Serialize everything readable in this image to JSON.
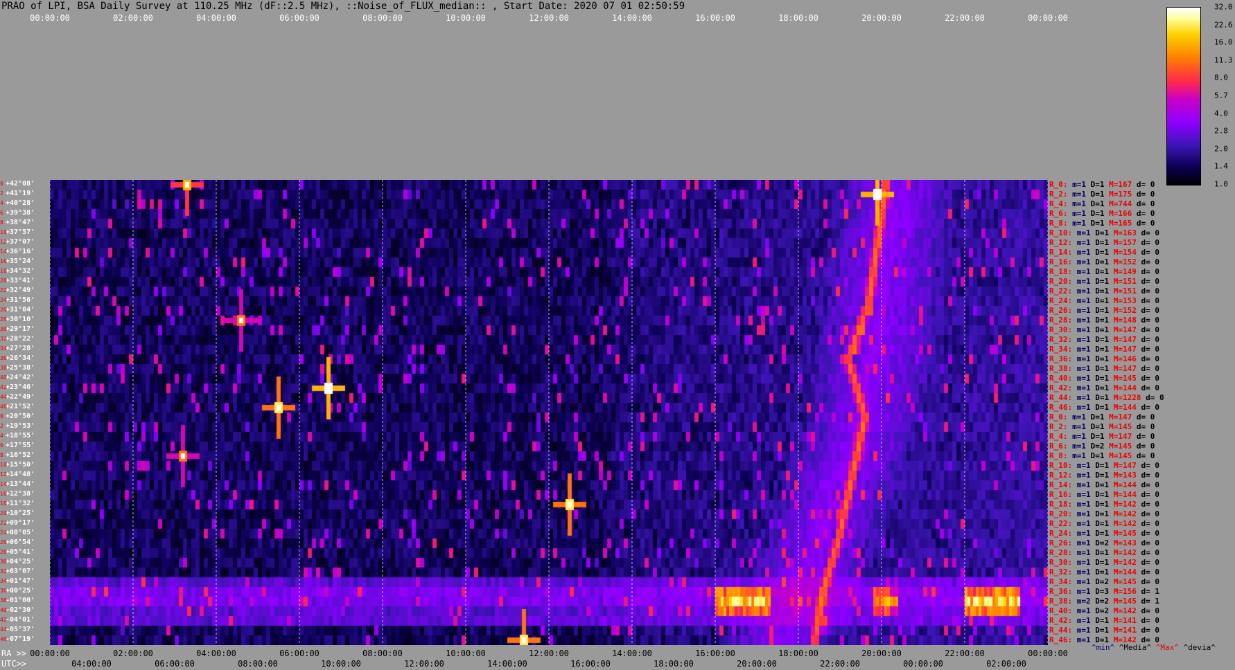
{
  "title": "PRAO of LPI, BSA Daily Survey at 110.25 MHz (dF::2.5 MHz), ::Noise_of_FLUX_median:: , Start Date: 2020 07 01 02:50:59",
  "top_axis_ticks": [
    "00:00:00",
    "02:00:00",
    "04:00:00",
    "06:00:00",
    "08:00:00",
    "10:00:00",
    "12:00:00",
    "14:00:00",
    "16:00:00",
    "18:00:00",
    "20:00:00",
    "22:00:00",
    "00:00:00"
  ],
  "ra_axis": {
    "label": "RA >>",
    "ticks": [
      "00:00:00",
      "02:00:00",
      "04:00:00",
      "06:00:00",
      "08:00:00",
      "10:00:00",
      "12:00:00",
      "14:00:00",
      "16:00:00",
      "18:00:00",
      "20:00:00",
      "22:00:00",
      "00:00:00"
    ]
  },
  "utc_axis": {
    "label": "UTC>>",
    "ticks": [
      "04:00:00",
      "06:00:00",
      "08:00:00",
      "10:00:00",
      "12:00:00",
      "14:00:00",
      "16:00:00",
      "18:00:00",
      "20:00:00",
      "22:00:00",
      "00:00:00",
      "02:00:00"
    ]
  },
  "colorbar_ticks": [
    "32.0",
    "22.6",
    "16.0",
    "11.3",
    "8.0",
    "5.7",
    "4.0",
    "2.8",
    "2.0",
    "1.4",
    "1.0"
  ],
  "legend_footer": [
    {
      "text": "^min^",
      "color": "#000080"
    },
    {
      "text": "^Media^",
      "color": "#000000"
    },
    {
      "text": "^Max^",
      "color": "#e00000"
    },
    {
      "text": "^devia^",
      "color": "#000000"
    }
  ],
  "chart_data": {
    "type": "heatmap",
    "title": "PRAO of LPI, BSA Daily Survey at 110.25 MHz (dF::2.5 MHz), ::Noise_of_FLUX_median:: , Start Date: 2020 07 01 02:50:59",
    "x_axis": "RA (hh:mm:ss), 00:00:00 to 24:00:00",
    "color_scale": {
      "min": 1.0,
      "max": 32.0,
      "type": "log2"
    },
    "declination_labels": [
      "+42°08'",
      "+41°19'",
      "+40°28'",
      "+39°38'",
      "+38°47'",
      "+37°57'",
      "+37°07'",
      "+36°16'",
      "+35°24'",
      "+34°32'",
      "+33°41'",
      "+32°49'",
      "+31°56'",
      "+31°04'",
      "+30°10'",
      "+29°17'",
      "+28°22'",
      "+27°28'",
      "+26°34'",
      "+25°38'",
      "+24°42'",
      "+23°46'",
      "+22°49'",
      "+21°52'",
      "+20°50'",
      "+19°53'",
      "+18°55'",
      "+17°55'",
      "+16°52'",
      "+15°50'",
      "+14°48'",
      "+13°44'",
      "+12°38'",
      "+11°32'",
      "+10°25'",
      "+09°17'",
      "+08°05'",
      "+06°54'",
      "+05°41'",
      "+04°25'",
      "+03°07'",
      "+01°47'",
      "+00°25'",
      "-01°00'",
      "-02°30'",
      "-04°01'",
      "-05°37'",
      "-07°19'"
    ],
    "row_index_labels": [
      "0",
      "2",
      "4",
      "6",
      "8",
      "10",
      "12",
      "14",
      "16",
      "18",
      "20",
      "22",
      "24",
      "26",
      "28",
      "30",
      "32",
      "34",
      "36",
      "38",
      "40",
      "42",
      "44",
      "46",
      "0",
      "2",
      "4",
      "6",
      "8",
      "10",
      "12",
      "14",
      "16",
      "18",
      "20",
      "22",
      "24",
      "26",
      "28",
      "30",
      "32",
      "34",
      "36",
      "38",
      "40",
      "42",
      "44",
      "46"
    ],
    "rows": [
      {
        "name": "R_0:",
        "min": "m=1",
        "d": "D=1",
        "max": "M=167",
        "dev": "d= 0"
      },
      {
        "name": "R_2:",
        "min": "m=1",
        "d": "D=1",
        "max": "M=175",
        "dev": "d= 0"
      },
      {
        "name": "R_4:",
        "min": "m=1",
        "d": "D=1",
        "max": "M=744",
        "dev": "d= 0"
      },
      {
        "name": "R_6:",
        "min": "m=1",
        "d": "D=1",
        "max": "M=166",
        "dev": "d= 0"
      },
      {
        "name": "R_8:",
        "min": "m=1",
        "d": "D=1",
        "max": "M=165",
        "dev": "d= 0"
      },
      {
        "name": "R_10:",
        "min": "m=1",
        "d": "D=1",
        "max": "M=163",
        "dev": "d= 0"
      },
      {
        "name": "R_12:",
        "min": "m=1",
        "d": "D=1",
        "max": "M=157",
        "dev": "d= 0"
      },
      {
        "name": "R_14:",
        "min": "m=1",
        "d": "D=1",
        "max": "M=154",
        "dev": "d= 0"
      },
      {
        "name": "R_16:",
        "min": "m=1",
        "d": "D=1",
        "max": "M=152",
        "dev": "d= 0"
      },
      {
        "name": "R_18:",
        "min": "m=1",
        "d": "D=1",
        "max": "M=149",
        "dev": "d= 0"
      },
      {
        "name": "R_20:",
        "min": "m=1",
        "d": "D=1",
        "max": "M=151",
        "dev": "d= 0"
      },
      {
        "name": "R_22:",
        "min": "m=1",
        "d": "D=1",
        "max": "M=151",
        "dev": "d= 0"
      },
      {
        "name": "R_24:",
        "min": "m=1",
        "d": "D=1",
        "max": "M=153",
        "dev": "d= 0"
      },
      {
        "name": "R_26:",
        "min": "m=1",
        "d": "D=1",
        "max": "M=152",
        "dev": "d= 0"
      },
      {
        "name": "R_28:",
        "min": "m=1",
        "d": "D=1",
        "max": "M=148",
        "dev": "d= 0"
      },
      {
        "name": "R_30:",
        "min": "m=1",
        "d": "D=1",
        "max": "M=147",
        "dev": "d= 0"
      },
      {
        "name": "R_32:",
        "min": "m=1",
        "d": "D=1",
        "max": "M=147",
        "dev": "d= 0"
      },
      {
        "name": "R_34:",
        "min": "m=1",
        "d": "D=1",
        "max": "M=147",
        "dev": "d= 0"
      },
      {
        "name": "R_36:",
        "min": "m=1",
        "d": "D=1",
        "max": "M=146",
        "dev": "d= 0"
      },
      {
        "name": "R_38:",
        "min": "m=1",
        "d": "D=1",
        "max": "M=147",
        "dev": "d= 0"
      },
      {
        "name": "R_40:",
        "min": "m=1",
        "d": "D=1",
        "max": "M=145",
        "dev": "d= 0"
      },
      {
        "name": "R_42:",
        "min": "m=1",
        "d": "D=1",
        "max": "M=144",
        "dev": "d= 0"
      },
      {
        "name": "R_44:",
        "min": "m=1",
        "d": "D=1",
        "max": "M=1228",
        "dev": "d= 0"
      },
      {
        "name": "R_46:",
        "min": "m=1",
        "d": "D=1",
        "max": "M=144",
        "dev": "d= 0"
      },
      {
        "name": "R_0:",
        "min": "m=1",
        "d": "D=1",
        "max": "M=147",
        "dev": "d= 0"
      },
      {
        "name": "R_2:",
        "min": "m=1",
        "d": "D=1",
        "max": "M=145",
        "dev": "d= 0"
      },
      {
        "name": "R_4:",
        "min": "m=1",
        "d": "D=1",
        "max": "M=147",
        "dev": "d= 0"
      },
      {
        "name": "R_6:",
        "min": "m=1",
        "d": "D=2",
        "max": "M=145",
        "dev": "d= 0"
      },
      {
        "name": "R_8:",
        "min": "m=1",
        "d": "D=1",
        "max": "M=145",
        "dev": "d= 0"
      },
      {
        "name": "R_10:",
        "min": "m=1",
        "d": "D=1",
        "max": "M=147",
        "dev": "d= 0"
      },
      {
        "name": "R_12:",
        "min": "m=1",
        "d": "D=1",
        "max": "M=143",
        "dev": "d= 0"
      },
      {
        "name": "R_14:",
        "min": "m=1",
        "d": "D=1",
        "max": "M=144",
        "dev": "d= 0"
      },
      {
        "name": "R_16:",
        "min": "m=1",
        "d": "D=1",
        "max": "M=144",
        "dev": "d= 0"
      },
      {
        "name": "R_18:",
        "min": "m=1",
        "d": "D=1",
        "max": "M=142",
        "dev": "d= 0"
      },
      {
        "name": "R_20:",
        "min": "m=1",
        "d": "D=1",
        "max": "M=142",
        "dev": "d= 0"
      },
      {
        "name": "R_22:",
        "min": "m=1",
        "d": "D=1",
        "max": "M=142",
        "dev": "d= 0"
      },
      {
        "name": "R_24:",
        "min": "m=1",
        "d": "D=1",
        "max": "M=145",
        "dev": "d= 0"
      },
      {
        "name": "R_26:",
        "min": "m=1",
        "d": "D=2",
        "max": "M=143",
        "dev": "d= 0"
      },
      {
        "name": "R_28:",
        "min": "m=1",
        "d": "D=1",
        "max": "M=142",
        "dev": "d= 0"
      },
      {
        "name": "R_30:",
        "min": "m=1",
        "d": "D=1",
        "max": "M=142",
        "dev": "d= 0"
      },
      {
        "name": "R_32:",
        "min": "m=1",
        "d": "D=1",
        "max": "M=144",
        "dev": "d= 0"
      },
      {
        "name": "R_34:",
        "min": "m=1",
        "d": "D=2",
        "max": "M=145",
        "dev": "d= 0"
      },
      {
        "name": "R_36:",
        "min": "m=1",
        "d": "D=3",
        "max": "M=156",
        "dev": "d= 1"
      },
      {
        "name": "R_38:",
        "min": "m=2",
        "d": "D=2",
        "max": "M=145",
        "dev": "d= 1"
      },
      {
        "name": "R_40:",
        "min": "m=1",
        "d": "D=2",
        "max": "M=142",
        "dev": "d= 0"
      },
      {
        "name": "R_42:",
        "min": "m=1",
        "d": "D=1",
        "max": "M=141",
        "dev": "d= 0"
      },
      {
        "name": "R_44:",
        "min": "m=1",
        "d": "D=1",
        "max": "M=141",
        "dev": "d= 0"
      },
      {
        "name": "R_46:",
        "min": "m=1",
        "d": "D=1",
        "max": "M=142",
        "dev": "d= 0"
      }
    ],
    "features": [
      {
        "kind": "point_source",
        "ra_hours": 6.7,
        "row": 21,
        "level": 32
      },
      {
        "kind": "point_source",
        "ra_hours": 5.5,
        "row": 23,
        "level": 22.6
      },
      {
        "kind": "point_source",
        "ra_hours": 19.9,
        "row": 1,
        "level": 32
      },
      {
        "kind": "point_source",
        "ra_hours": 12.5,
        "row": 33,
        "level": 22.6
      },
      {
        "kind": "point_source",
        "ra_hours": 11.4,
        "row": 47,
        "level": 22.6
      },
      {
        "kind": "point_source",
        "ra_hours": 3.3,
        "row": 0,
        "level": 16
      },
      {
        "kind": "point_source",
        "ra_hours": 3.2,
        "row": 28,
        "level": 11.3
      },
      {
        "kind": "point_source",
        "ra_hours": 4.6,
        "row": 14,
        "level": 11.3
      },
      {
        "kind": "band",
        "ra_start": 16.0,
        "ra_end": 17.3,
        "rows": [
          42,
          44
        ],
        "level": 22.6
      },
      {
        "kind": "band",
        "ra_start": 19.8,
        "ra_end": 20.4,
        "rows": [
          42,
          44
        ],
        "level": 16
      },
      {
        "kind": "band",
        "ra_start": 22.0,
        "ra_end": 23.3,
        "rows": [
          42,
          44
        ],
        "level": 22.6
      },
      {
        "kind": "galactic_plane",
        "ra_hours_by_row": [
          [
            0,
            20.1
          ],
          [
            6,
            19.9
          ],
          [
            12,
            19.7
          ],
          [
            18,
            19.2
          ],
          [
            24,
            19.6
          ],
          [
            30,
            19.3
          ],
          [
            36,
            19.0
          ],
          [
            42,
            18.6
          ],
          [
            47,
            18.4
          ]
        ],
        "level": 8
      },
      {
        "kind": "galactic_plane_halo",
        "ra_hours_by_row": [
          [
            0,
            20.3
          ],
          [
            12,
            20.0
          ],
          [
            24,
            19.6
          ],
          [
            36,
            18.6
          ],
          [
            47,
            17.5
          ]
        ],
        "level": 2.8
      }
    ]
  }
}
